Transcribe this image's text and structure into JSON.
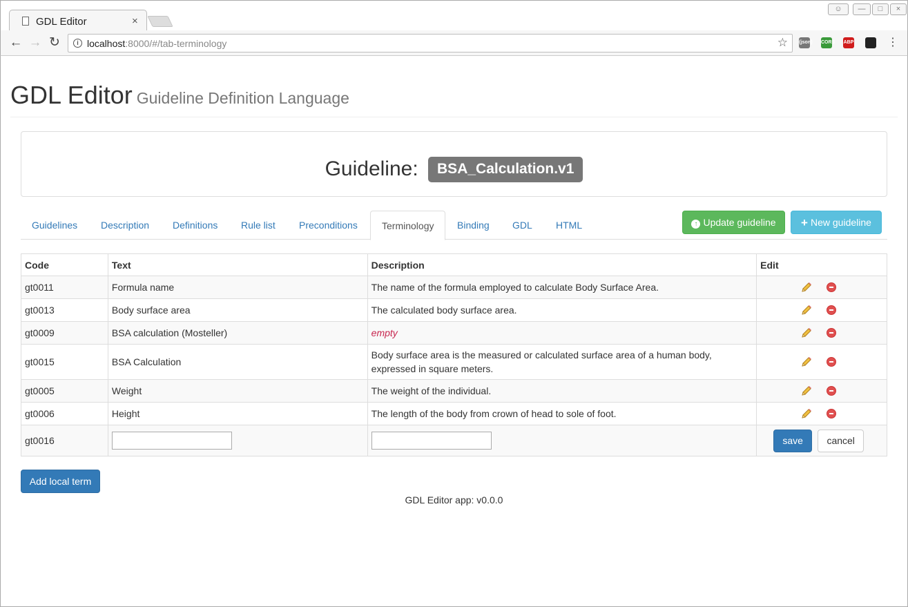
{
  "browser": {
    "tab_title": "GDL Editor",
    "tab_close": "×",
    "url_host": "localhost",
    "url_path": ":8000/#/tab-terminology",
    "info_glyph": "i",
    "extensions": [
      {
        "name": "json-ext-icon",
        "label": "{json}",
        "color": "#777777"
      },
      {
        "name": "cors-ext-icon",
        "label": "CORS",
        "color": "#3a9a3a"
      },
      {
        "name": "adblock-ext-icon",
        "label": "ABP",
        "color": "#d01c1c"
      },
      {
        "name": "paw-ext-icon",
        "label": "",
        "color": "#222222"
      }
    ]
  },
  "header": {
    "title": "GDL Editor",
    "subtitle": "Guideline Definition Language"
  },
  "guideline": {
    "label": "Guideline:",
    "name": "BSA_Calculation.v1"
  },
  "tabs": [
    {
      "label": "Guidelines",
      "active": false
    },
    {
      "label": "Description",
      "active": false
    },
    {
      "label": "Definitions",
      "active": false
    },
    {
      "label": "Rule list",
      "active": false
    },
    {
      "label": "Preconditions",
      "active": false
    },
    {
      "label": "Terminology",
      "active": true
    },
    {
      "label": "Binding",
      "active": false
    },
    {
      "label": "GDL",
      "active": false
    },
    {
      "label": "HTML",
      "active": false
    }
  ],
  "actions": {
    "update_label": "Update guideline",
    "new_label": "New guideline"
  },
  "table": {
    "headers": {
      "code": "Code",
      "text": "Text",
      "description": "Description",
      "edit": "Edit"
    },
    "rows": [
      {
        "code": "gt0011",
        "text": "Formula name",
        "description": "The name of the formula employed to calculate Body Surface Area.",
        "empty": false
      },
      {
        "code": "gt0013",
        "text": "Body surface area",
        "description": "The calculated body surface area.",
        "empty": false
      },
      {
        "code": "gt0009",
        "text": "BSA calculation (Mosteller)",
        "description": "empty",
        "empty": true
      },
      {
        "code": "gt0015",
        "text": "BSA Calculation",
        "description": "Body surface area is the measured or calculated surface area of a human body, expressed in square meters.",
        "empty": false
      },
      {
        "code": "gt0005",
        "text": "Weight",
        "description": "The weight of the individual.",
        "empty": false
      },
      {
        "code": "gt0006",
        "text": "Height",
        "description": "The length of the body from crown of head to sole of foot.",
        "empty": false
      }
    ],
    "new_row": {
      "code": "gt0016",
      "text_value": "",
      "description_value": "",
      "save_label": "save",
      "cancel_label": "cancel"
    }
  },
  "add_term_label": "Add local term",
  "footer": "GDL Editor app: v0.0.0"
}
